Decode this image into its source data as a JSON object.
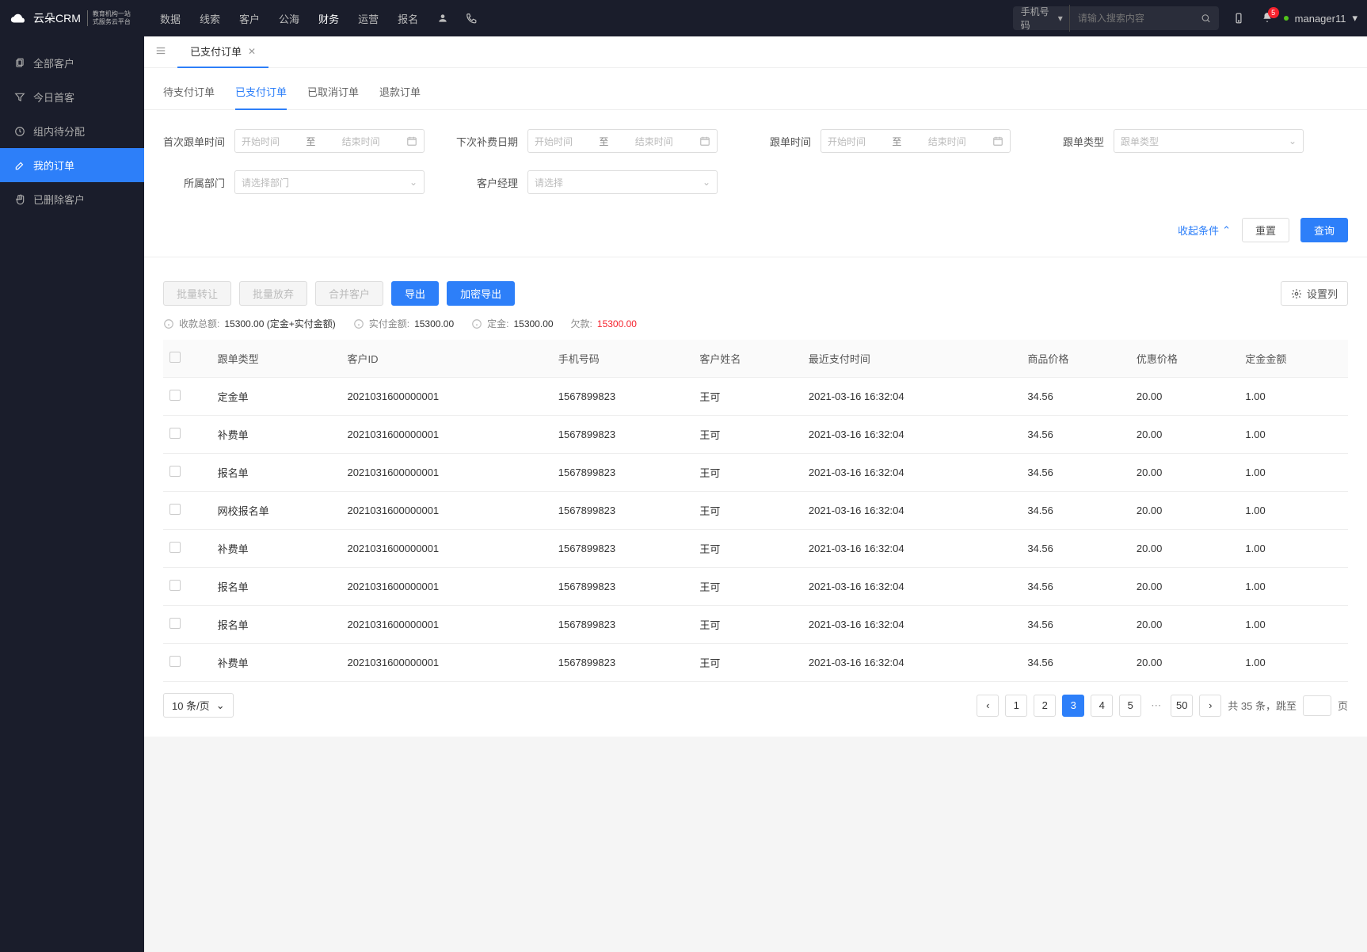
{
  "header": {
    "logo_text": "云朵CRM",
    "logo_sub1": "教育机构一站",
    "logo_sub2": "式服务云平台",
    "nav": [
      "数据",
      "线索",
      "客户",
      "公海",
      "财务",
      "运营",
      "报名"
    ],
    "nav_active_index": 4,
    "search_category": "手机号码",
    "search_placeholder": "请输入搜索内容",
    "notification_count": "5",
    "username": "manager11"
  },
  "sidebar": {
    "items": [
      {
        "label": "全部客户",
        "icon": "copy"
      },
      {
        "label": "今日首客",
        "icon": "filter"
      },
      {
        "label": "组内待分配",
        "icon": "clock"
      },
      {
        "label": "我的订单",
        "icon": "edit",
        "active": true
      },
      {
        "label": "已删除客户",
        "icon": "hand"
      }
    ]
  },
  "tabs": {
    "main_tab": "已支付订单",
    "sub_tabs": [
      "待支付订单",
      "已支付订单",
      "已取消订单",
      "退款订单"
    ],
    "sub_active_index": 1
  },
  "filters": {
    "first_follow": {
      "label": "首次跟单时间",
      "start": "开始时间",
      "to": "至",
      "end": "结束时间"
    },
    "next_renewal": {
      "label": "下次补费日期",
      "start": "开始时间",
      "to": "至",
      "end": "结束时间"
    },
    "follow_time": {
      "label": "跟单时间",
      "start": "开始时间",
      "to": "至",
      "end": "结束时间"
    },
    "follow_type": {
      "label": "跟单类型",
      "placeholder": "跟单类型"
    },
    "department": {
      "label": "所属部门",
      "placeholder": "请选择部门"
    },
    "account_mgr": {
      "label": "客户经理",
      "placeholder": "请选择"
    },
    "collapse": "收起条件",
    "reset": "重置",
    "query": "查询"
  },
  "toolbar": {
    "batch_transfer": "批量转让",
    "batch_abandon": "批量放弃",
    "merge_customer": "合并客户",
    "export": "导出",
    "encrypt_export": "加密导出",
    "set_columns": "设置列"
  },
  "stats": {
    "total_receipt_label": "收款总额:",
    "total_receipt_value": "15300.00 (定金+实付金额)",
    "paid_label": "实付金额:",
    "paid_value": "15300.00",
    "deposit_label": "定金:",
    "deposit_value": "15300.00",
    "debt_label": "欠款:",
    "debt_value": "15300.00"
  },
  "table": {
    "headers": [
      "跟单类型",
      "客户ID",
      "手机号码",
      "客户姓名",
      "最近支付时间",
      "商品价格",
      "优惠价格",
      "定金金额"
    ],
    "rows": [
      {
        "type": "定金单",
        "id": "2021031600000001",
        "phone": "1567899823",
        "name": "王可",
        "time": "2021-03-16 16:32:04",
        "price": "34.56",
        "discount": "20.00",
        "deposit": "1.00"
      },
      {
        "type": "补费单",
        "id": "2021031600000001",
        "phone": "1567899823",
        "name": "王可",
        "time": "2021-03-16 16:32:04",
        "price": "34.56",
        "discount": "20.00",
        "deposit": "1.00"
      },
      {
        "type": "报名单",
        "id": "2021031600000001",
        "phone": "1567899823",
        "name": "王可",
        "time": "2021-03-16 16:32:04",
        "price": "34.56",
        "discount": "20.00",
        "deposit": "1.00"
      },
      {
        "type": "网校报名单",
        "id": "2021031600000001",
        "phone": "1567899823",
        "name": "王可",
        "time": "2021-03-16 16:32:04",
        "price": "34.56",
        "discount": "20.00",
        "deposit": "1.00"
      },
      {
        "type": "补费单",
        "id": "2021031600000001",
        "phone": "1567899823",
        "name": "王可",
        "time": "2021-03-16 16:32:04",
        "price": "34.56",
        "discount": "20.00",
        "deposit": "1.00"
      },
      {
        "type": "报名单",
        "id": "2021031600000001",
        "phone": "1567899823",
        "name": "王可",
        "time": "2021-03-16 16:32:04",
        "price": "34.56",
        "discount": "20.00",
        "deposit": "1.00"
      },
      {
        "type": "报名单",
        "id": "2021031600000001",
        "phone": "1567899823",
        "name": "王可",
        "time": "2021-03-16 16:32:04",
        "price": "34.56",
        "discount": "20.00",
        "deposit": "1.00"
      },
      {
        "type": "补费单",
        "id": "2021031600000001",
        "phone": "1567899823",
        "name": "王可",
        "time": "2021-03-16 16:32:04",
        "price": "34.56",
        "discount": "20.00",
        "deposit": "1.00"
      }
    ]
  },
  "pagination": {
    "page_size": "10 条/页",
    "pages": [
      "1",
      "2",
      "3",
      "4",
      "5"
    ],
    "active_page": "3",
    "last_page": "50",
    "total_prefix": "共",
    "total_count": "35",
    "total_suffix": "条，跳至",
    "page_unit": "页"
  }
}
